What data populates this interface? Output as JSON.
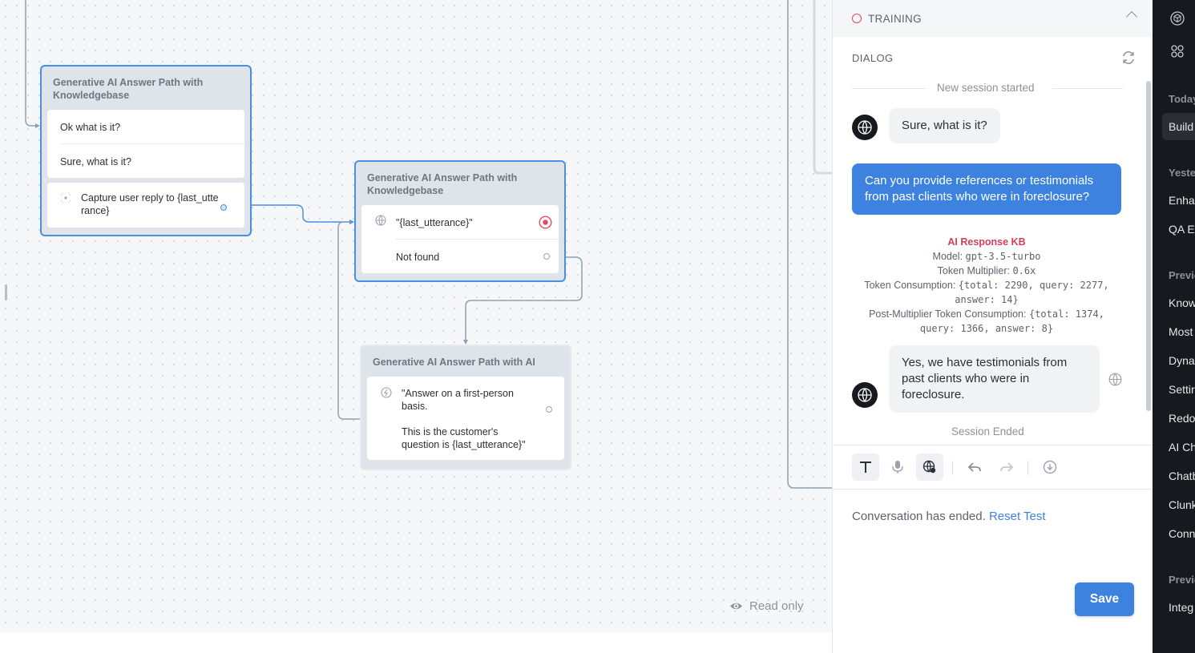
{
  "canvas": {
    "read_only_label": "Read only",
    "blocks": [
      {
        "title": "Generative AI Answer Path with Knowledgebase",
        "steps": [
          "Ok what is it?",
          "Sure, what is it?"
        ],
        "capture": "Capture user reply to {last_utterance}"
      },
      {
        "title": "Generative AI Answer Path with Knowledgebase",
        "kb_step": "\"{last_utterance}\"",
        "not_found": "Not found"
      },
      {
        "title": "Generative AI Answer Path with AI",
        "prompt_line1": "\"Answer on a first-person basis.",
        "prompt_line2": "This is the customer's question is {last_utterance}\""
      }
    ]
  },
  "panel": {
    "training_label": "TRAINING",
    "dialog_label": "DIALOG",
    "session_started": "New session started",
    "session_ended": "Session Ended",
    "messages": {
      "bot_1": "Sure, what is it?",
      "user_1": "Can you provide references or testimonials from past clients who were in foreclosure?",
      "bot_2": "Yes, we have testimonials from past clients who were in foreclosure."
    },
    "debug": {
      "title": "AI Response KB",
      "model_label": "Model: ",
      "model_value": "gpt-3.5-turbo",
      "multiplier_label": "Token Multiplier: ",
      "multiplier_value": "0.6x",
      "consumption_label": "Token Consumption: ",
      "consumption_value": "{total: 2290, query: 2277, answer: 14}",
      "post_label": "Post-Multiplier Token Consumption: ",
      "post_value": "{total: 1374, query: 1366, answer: 8}"
    },
    "ended_text": "Conversation has ended.",
    "reset_link": "Reset Test",
    "save_label": "Save"
  },
  "sidebar": {
    "sections": {
      "today": "Today",
      "yesterday": "Yeste",
      "previous_1": "Previo",
      "previous_2": "Previo"
    },
    "items": {
      "today": [
        "Build"
      ],
      "yesterday": [
        "Enha",
        "QA E"
      ],
      "previous": [
        "Know",
        "Most",
        "Dyna",
        "Settir",
        "Redo",
        "AI Ch",
        "Chatb",
        "Clunk",
        "Conn"
      ],
      "previous_2": [
        "Integ"
      ]
    }
  },
  "colors": {
    "accent": "#3d82de",
    "selected_border": "#4a8fe2",
    "debug_title": "#d43f5e",
    "recording": "#e5485e"
  }
}
